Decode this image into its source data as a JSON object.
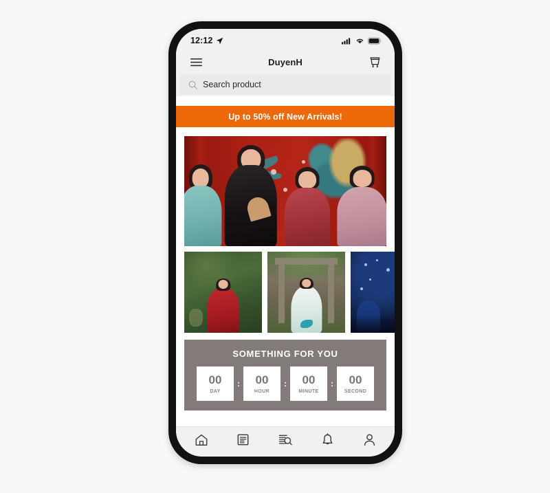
{
  "frame": {
    "device": "smartphone"
  },
  "status_bar": {
    "time": "12:12",
    "location_icon": "location-arrow-icon",
    "signal_icon": "cellular-signal-icon",
    "wifi_icon": "wifi-icon",
    "battery_icon": "battery-full-icon"
  },
  "app_bar": {
    "menu_icon": "hamburger-menu-icon",
    "title": "DuyenH",
    "cart_icon": "shopping-cart-icon"
  },
  "search": {
    "icon": "search-icon",
    "placeholder": "Search product",
    "value": ""
  },
  "promo_banner": {
    "text": "Up to 50% off New Arrivals!",
    "background_color": "#ED6806",
    "text_color": "#FFFFFF"
  },
  "hero": {
    "alt": "Four models wearing ao dai in front of a red peacock backdrop"
  },
  "thumbnails": [
    {
      "alt": "Model in red ao dai in a garden"
    },
    {
      "alt": "Model in white and mint ao dai at a pavilion"
    },
    {
      "alt": "Night performance scene with blue lights"
    }
  ],
  "countdown": {
    "title": "SOMETHING FOR YOU",
    "panel_color": "#837B79",
    "separator": ":",
    "units": [
      {
        "value": "00",
        "label": "DAY"
      },
      {
        "value": "00",
        "label": "HOUR"
      },
      {
        "value": "00",
        "label": "MINUTE"
      },
      {
        "value": "00",
        "label": "SECOND"
      }
    ]
  },
  "bottom_nav": [
    {
      "icon": "home-icon",
      "name": "home"
    },
    {
      "icon": "document-list-icon",
      "name": "catalog"
    },
    {
      "icon": "order-search-icon",
      "name": "order-lookup"
    },
    {
      "icon": "bell-icon",
      "name": "notifications"
    },
    {
      "icon": "person-icon",
      "name": "account"
    }
  ]
}
